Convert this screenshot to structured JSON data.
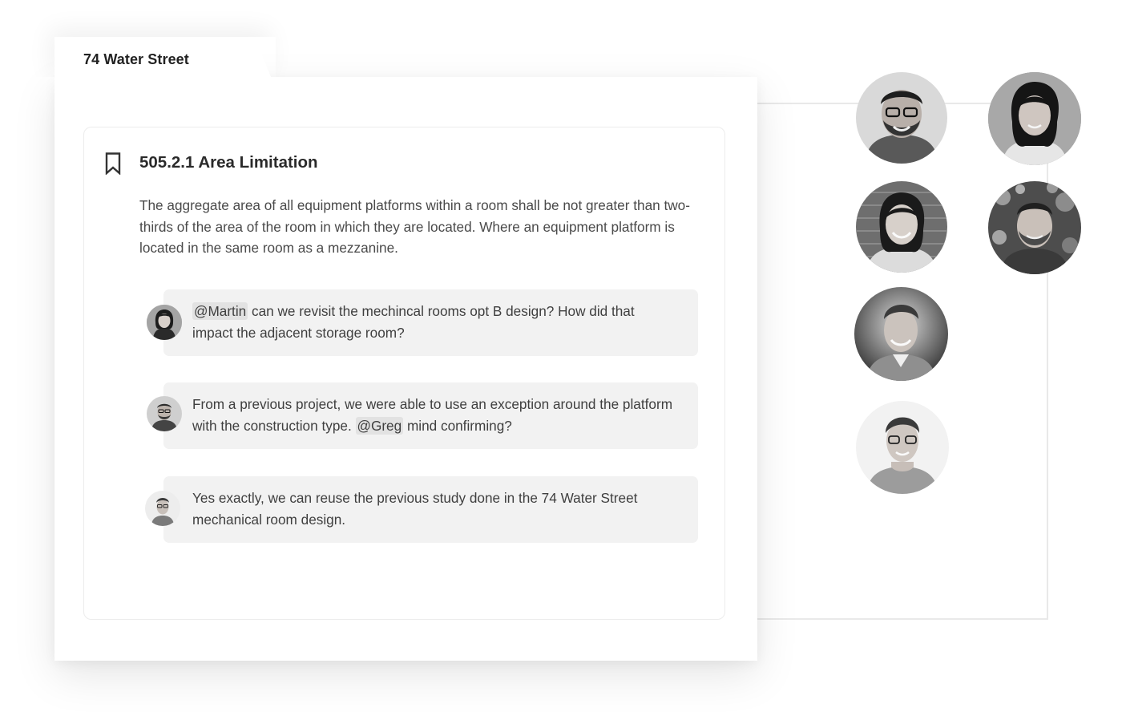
{
  "folder": {
    "title": "74 Water Street"
  },
  "section": {
    "title": "505.2.1 Area Limitation",
    "body": "The aggregate area of all equipment platforms within a room shall be not greater than two-thirds of the area of the room in which they are located. Where an equipment platform is located in the same room as a mezzanine."
  },
  "comments": [
    {
      "mention": "@Martin",
      "text_before": "",
      "text_after": " can we revisit the mechincal rooms opt B design? How did that impact the adjacent storage room?"
    },
    {
      "mention": "@Greg",
      "text_before": "From a previous project, we were able to use an exception around the platform with the construction type. ",
      "text_after": " mind confirming?"
    },
    {
      "mention": "",
      "text_before": "Yes exactly, we can reuse the previous study done in the 74 Water Street mechanical room design.",
      "text_after": ""
    }
  ],
  "icons": {
    "bookmark": "bookmark-icon"
  }
}
